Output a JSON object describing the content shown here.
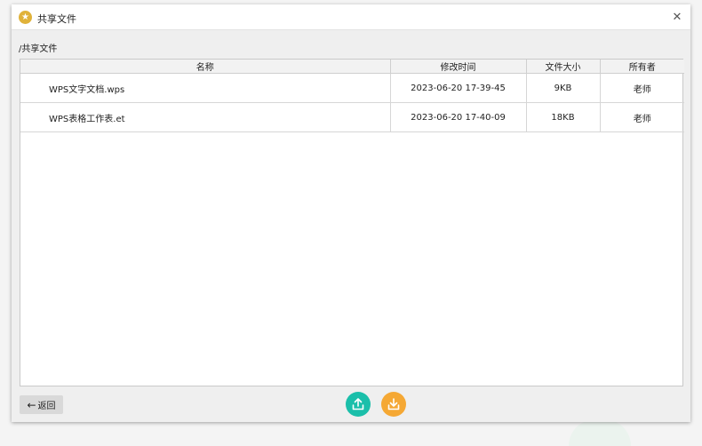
{
  "window": {
    "title": "共享文件",
    "icon": "star-icon",
    "accent_icon_color": "#e0b23a"
  },
  "breadcrumb": {
    "path": "/共享文件"
  },
  "table": {
    "columns": [
      "名称",
      "修改时间",
      "文件大小",
      "所有者"
    ],
    "rows": [
      {
        "name": "WPS文字文档.wps",
        "modified": "2023-06-20 17-39-45",
        "size": "9KB",
        "owner": "老师"
      },
      {
        "name": "WPS表格工作表.et",
        "modified": "2023-06-20 17-40-09",
        "size": "18KB",
        "owner": "老师"
      }
    ]
  },
  "footer": {
    "back_label": "返回",
    "upload_icon": "upload-icon",
    "download_icon": "download-icon",
    "upload_color": "#1bbfaa",
    "download_color": "#f5a834"
  }
}
